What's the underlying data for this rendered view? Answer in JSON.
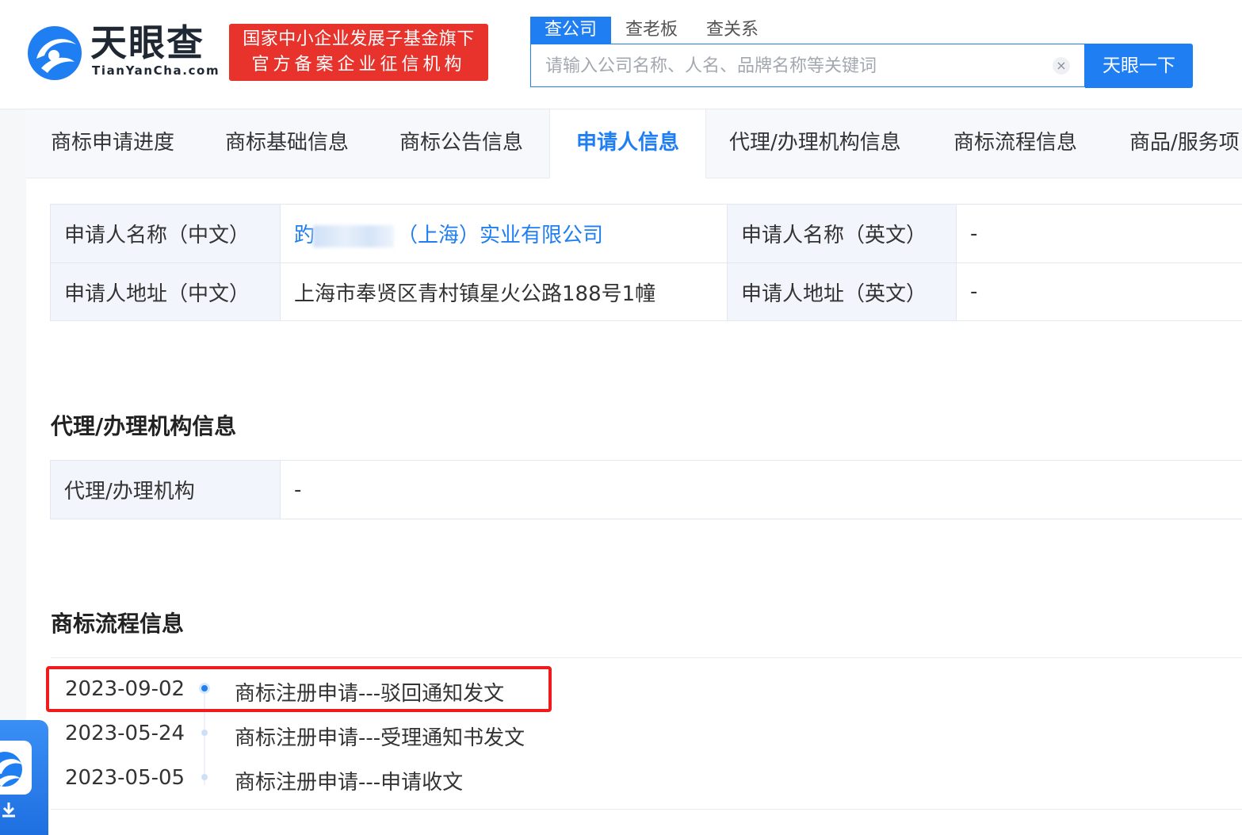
{
  "header": {
    "logo_text": "天眼查",
    "logo_sub": "TianYanCha.com",
    "badge_line1": "国家中小企业发展子基金旗下",
    "badge_line2": "官方备案企业征信机构",
    "search_tabs": [
      "查公司",
      "查老板",
      "查关系"
    ],
    "search_placeholder": "请输入公司名称、人名、品牌名称等关键词",
    "search_button": "天眼一下",
    "clear_glyph": "×"
  },
  "subnav": {
    "items": [
      "商标申请进度",
      "商标基础信息",
      "商标公告信息",
      "申请人信息",
      "代理/办理机构信息",
      "商标流程信息",
      "商品/服务项"
    ],
    "active_index": 3
  },
  "applicant": {
    "name_cn_label": "申请人名称（中文）",
    "name_cn_prefix": "趵",
    "name_cn_suffix": "（上海）实业有限公司",
    "name_en_label": "申请人名称（英文）",
    "name_en_value": "-",
    "addr_cn_label": "申请人地址（中文）",
    "addr_cn_value": "上海市奉贤区青村镇星火公路188号1幢",
    "addr_en_label": "申请人地址（英文）",
    "addr_en_value": "-"
  },
  "agency": {
    "title": "代理/办理机构信息",
    "label": "代理/办理机构",
    "value": "-"
  },
  "process": {
    "title": "商标流程信息",
    "events": [
      {
        "date": "2023-09-02",
        "text": "商标注册申请---驳回通知发文",
        "highlighted": true
      },
      {
        "date": "2023-05-24",
        "text": "商标注册申请---受理通知书发文",
        "highlighted": false
      },
      {
        "date": "2023-05-05",
        "text": "商标注册申请---申请收文",
        "highlighted": false
      }
    ]
  },
  "colors": {
    "brand_blue": "#1e7ef2",
    "badge_red": "#e8332d",
    "highlight_red": "#ee1c1c"
  }
}
